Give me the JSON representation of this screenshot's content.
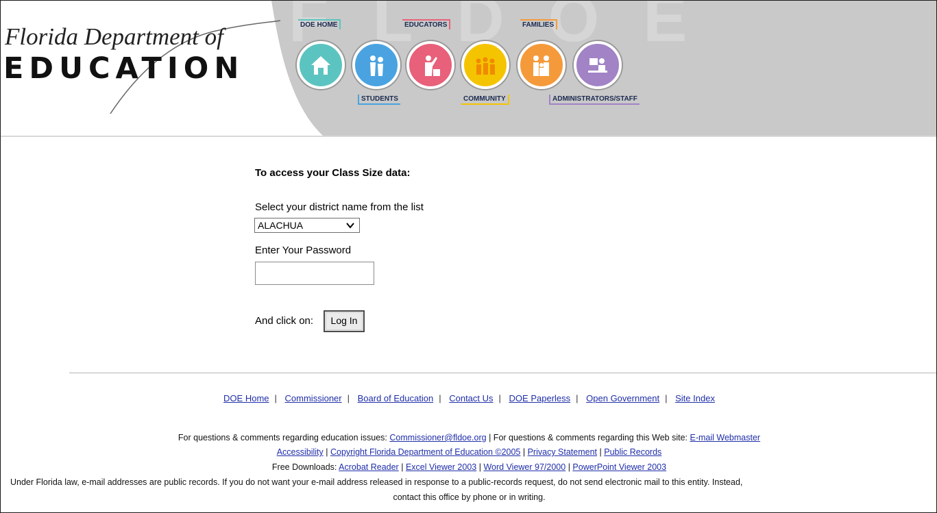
{
  "header": {
    "logo_script": "Florida Department of",
    "logo_word": "EDUCATION",
    "watermark": "FLDOE",
    "nav": [
      {
        "label": "DOE HOME",
        "icon": "house-icon",
        "color": "#5cc4c0"
      },
      {
        "label": "STUDENTS",
        "icon": "students-icon",
        "color": "#4aa3e0"
      },
      {
        "label": "EDUCATORS",
        "icon": "teacher-icon",
        "color": "#e8607a"
      },
      {
        "label": "COMMUNITY",
        "icon": "community-icon",
        "color": "#f5c400"
      },
      {
        "label": "FAMILIES",
        "icon": "family-icon",
        "color": "#f59a3a"
      },
      {
        "label": "ADMINISTRATORS/STAFF",
        "icon": "administrator-icon",
        "color": "#a183c6"
      }
    ]
  },
  "form": {
    "title": "To access your Class Size data:",
    "select_label": "Select your district name from the list",
    "district_selected": "ALACHUA",
    "password_label": "Enter Your Password",
    "password_value": "",
    "click_label": "And click on:",
    "login_label": "Log In"
  },
  "footer": {
    "links": [
      "DOE Home",
      "Commissioner",
      "Board of Education",
      "Contact Us",
      "DOE Paperless",
      "Open Government",
      "Site Index"
    ],
    "line1_prefix": "For questions & comments regarding education issues: ",
    "line1_email": "Commissioner@fldoe.org",
    "line1_middle": " | For questions & comments regarding this Web site: ",
    "line1_webmaster": "E-mail Webmaster",
    "line2": [
      "Accessibility",
      "Copyright Florida Department of Education ©2005",
      "Privacy Statement",
      "Public Records"
    ],
    "line3_prefix": "Free Downloads: ",
    "line3": [
      "Acrobat Reader",
      "Excel Viewer 2003",
      "Word Viewer 97/2000",
      "PowerPoint Viewer 2003"
    ],
    "line4": "Under Florida law, e-mail addresses are public records. If you do not want your e-mail address released in response to a public-records request, do not send electronic mail to this entity. Instead,",
    "line5": "contact this office by phone or in writing."
  },
  "colors": {
    "header_bg": "#c9c9c9",
    "link": "#1f2ea8"
  }
}
